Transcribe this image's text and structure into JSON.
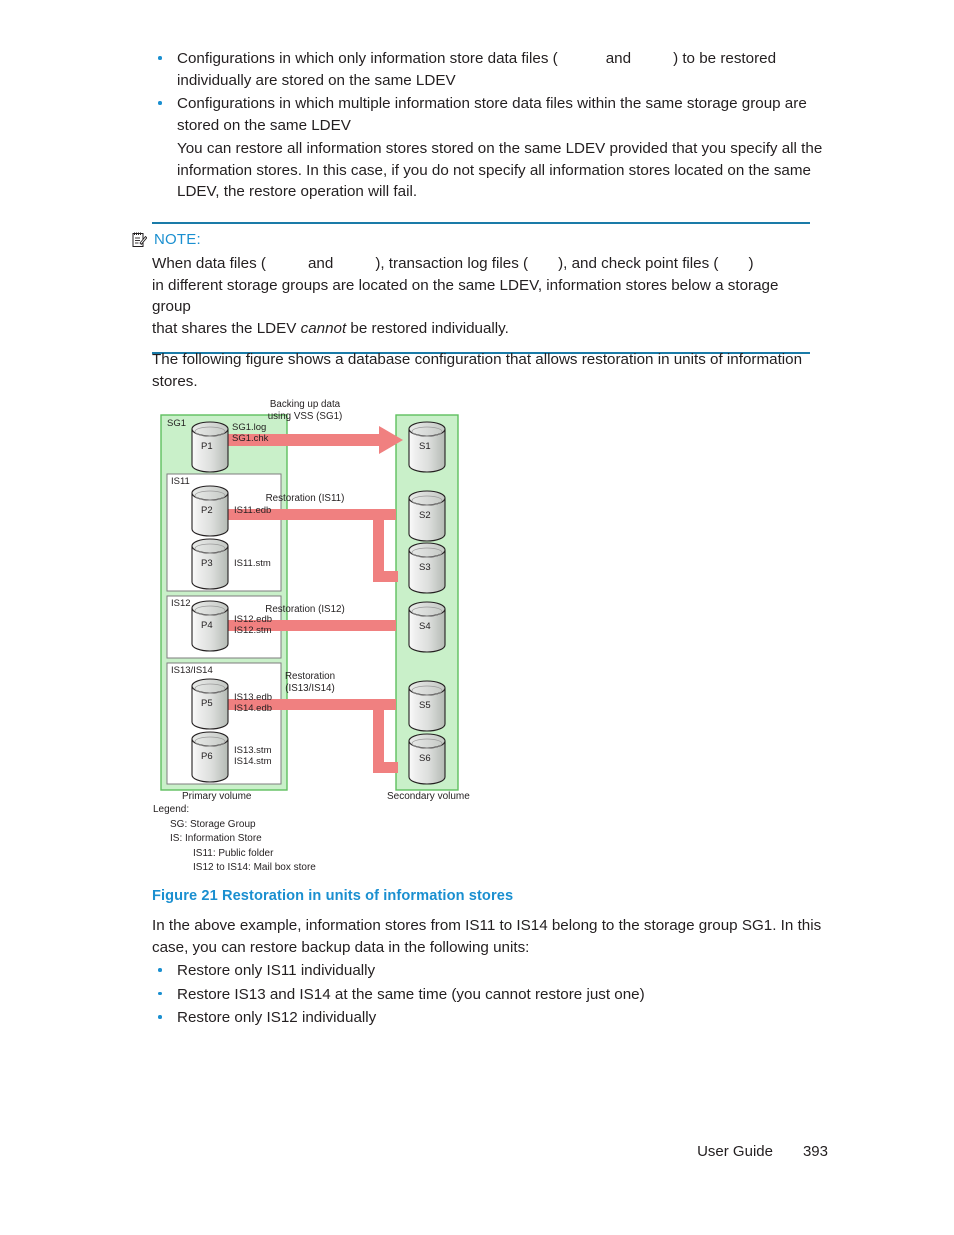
{
  "document": {
    "footer_label": "User Guide",
    "page_number": "393"
  },
  "top_bullets": [
    {
      "text_before": "Configurations in which only information store data files (",
      "text_mid": "and",
      "text_after": ") to be restored individually are stored on the same LDEV"
    },
    {
      "text": "Configurations in which multiple information store data files within the same storage group are stored on the same LDEV"
    }
  ],
  "top_paragraph": "You can restore all information stores stored on the same LDEV provided that you specify all the information stores. In this case, if you do not specify all information stores located on the same LDEV, the restore operation will fail.",
  "note": {
    "icon": "note-pen-icon",
    "title": "NOTE:",
    "seg1": "When data files (",
    "seg2": "and",
    "seg3": "), transaction log files (",
    "seg4": "), and check point files (",
    "seg5": ")",
    "line2": "in different storage groups are located on the same LDEV, information stores below a storage group",
    "line3_before": "that shares the LDEV ",
    "line3_italic": "cannot",
    "line3_after": " be restored individually.",
    "rule_color": "#1a7ba8"
  },
  "figure_intro": "The following figure shows a database configuration that allows restoration in units of information stores.",
  "figure": {
    "caption_number": "Figure 21",
    "caption_title": "Restoration in units of information stores",
    "primary_volume_caption": "Primary volume",
    "secondary_volume_caption": "Secondary volume",
    "panels": {
      "sg1": "SG1",
      "is11": "IS11",
      "is12": "IS12",
      "is13_14": "IS13/IS14"
    },
    "primary_cylinders": [
      {
        "id": "P1",
        "files": [
          "SG1.log",
          "SG1.chk"
        ]
      },
      {
        "id": "P2",
        "files": [
          "IS11.edb"
        ]
      },
      {
        "id": "P3",
        "files": [
          "IS11.stm"
        ]
      },
      {
        "id": "P4",
        "files": [
          "IS12.edb",
          "IS12.stm"
        ]
      },
      {
        "id": "P5",
        "files": [
          "IS13.edb",
          "IS14.edb"
        ]
      },
      {
        "id": "P6",
        "files": [
          "IS13.stm",
          "IS14.stm"
        ]
      }
    ],
    "secondary_cylinders": [
      {
        "id": "S1"
      },
      {
        "id": "S2"
      },
      {
        "id": "S3"
      },
      {
        "id": "S4"
      },
      {
        "id": "S5"
      },
      {
        "id": "S6"
      }
    ],
    "arrows": [
      {
        "label_line1": "Backing up data",
        "label_line2": "using VSS (SG1)",
        "direction": "right"
      },
      {
        "label_line1": "Restoration (IS11)",
        "label_line2": "",
        "direction": "left"
      },
      {
        "label_line1": "Restoration (IS12)",
        "label_line2": "",
        "direction": "left"
      },
      {
        "label_line1": "Restoration",
        "label_line2": "(IS13/IS14)",
        "direction": "left"
      }
    ],
    "colors": {
      "panel_fill": "#c9f0c9",
      "panel_border": "#5fbf5f",
      "arrow": "#f08080",
      "cylinder_light": "#f2f2f2",
      "cylinder_dark": "#b8bdb8"
    }
  },
  "legend": {
    "title": "Legend:",
    "entries": [
      {
        "level": 1,
        "text": "SG: Storage Group"
      },
      {
        "level": 1,
        "text": "IS: Information Store"
      },
      {
        "level": 2,
        "text": "IS11: Public folder"
      },
      {
        "level": 2,
        "text": "IS12 to IS14: Mail box store"
      }
    ]
  },
  "after_figure_paragraph": "In the above example, information stores from IS11 to IS14 belong to the storage group SG1. In this case, you can restore backup data in the following units:",
  "after_bullets": [
    "Restore only IS11 individually",
    "Restore IS13 and IS14 at the same time (you cannot restore just one)",
    "Restore only IS12 individually"
  ]
}
